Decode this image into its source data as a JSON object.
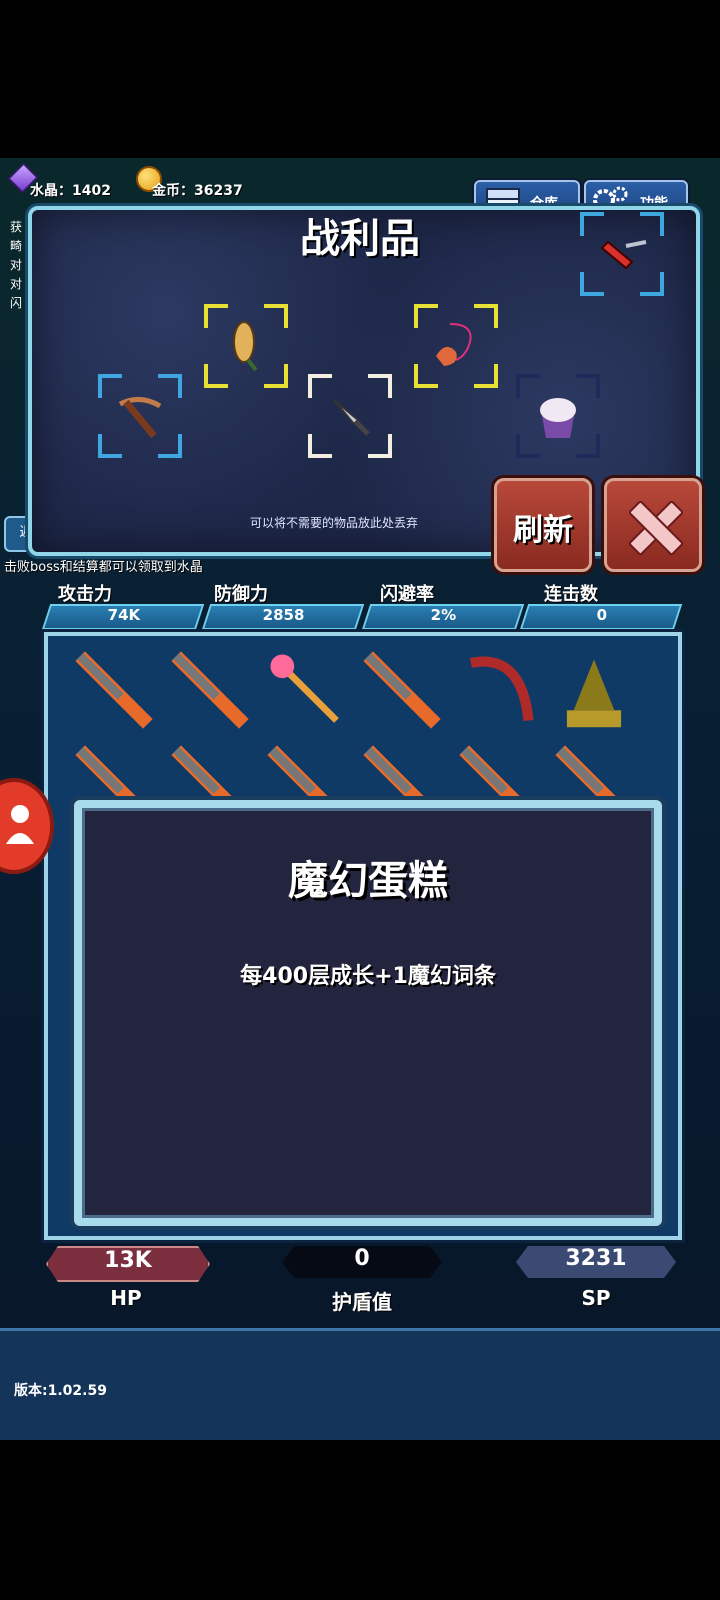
{
  "resources": {
    "crystal_label": "水晶：1402",
    "gold_label": "金币：36237"
  },
  "top_buttons": {
    "warehouse": "仓库",
    "function": "功能"
  },
  "loot": {
    "title": "战利品",
    "discard_hint": "可以将不需要的物品放此处丢弃",
    "items": [
      {
        "name": "crossbow",
        "frame": "#3fa7e0"
      },
      {
        "name": "golden-corn",
        "frame": "#e8e034"
      },
      {
        "name": "kunai",
        "frame": "#f2efe2"
      },
      {
        "name": "shadow-amulet",
        "frame": "#e8e034"
      },
      {
        "name": "magic-cake",
        "frame": "#1f2a5a"
      },
      {
        "name": "red-knife",
        "frame": "#3fa7e0"
      }
    ]
  },
  "buttons": {
    "refresh": "刷新"
  },
  "hint_text": "击败boss和结算都可以领取到水晶",
  "left_partial": [
    "获",
    "畸",
    "对",
    "对",
    "闪"
  ],
  "left_button": "返",
  "stats": [
    {
      "label": "攻击力",
      "value": "74K"
    },
    {
      "label": "防御力",
      "value": "2858"
    },
    {
      "label": "闪避率",
      "value": "2%"
    },
    {
      "label": "连击数",
      "value": "0"
    }
  ],
  "inventory": {
    "row1": [
      "flame-sword",
      "flame-sword",
      "pink-staff",
      "flame-sword",
      "red-scythe",
      "golden-dragon-statue"
    ],
    "row2": [
      "flame-sword",
      "flame-sword",
      "flame-sword",
      "flame-sword",
      "flame-sword",
      "flame-sword"
    ]
  },
  "detail": {
    "title": "魔幻蛋糕",
    "description": "每400层成长+1魔幻词条"
  },
  "bars": {
    "hp_value": "13K",
    "hp_label": "HP",
    "shield_value": "0",
    "shield_label": "护盾值",
    "sp_value": "3231",
    "sp_label": "SP"
  },
  "version": "版本:1.02.59"
}
